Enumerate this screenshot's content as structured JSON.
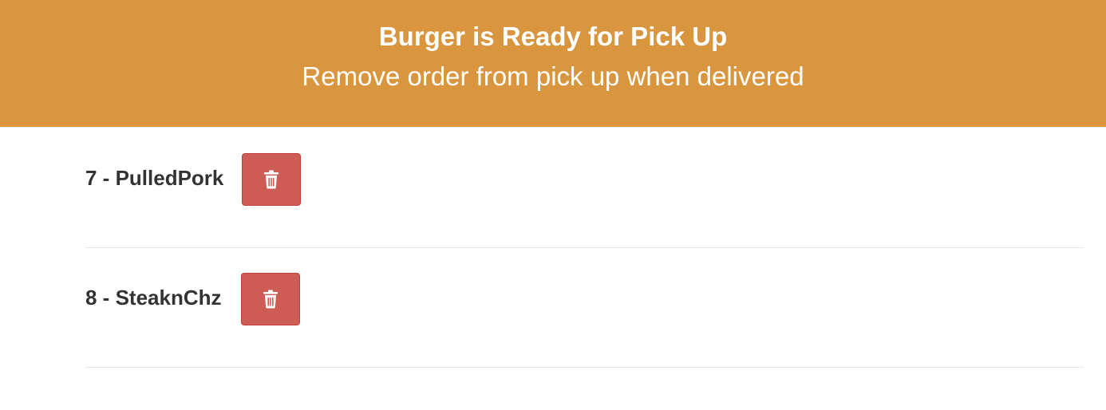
{
  "banner": {
    "title": "Burger is Ready for Pick Up",
    "subtitle": "Remove order from pick up when delivered",
    "background_color": "#d9963e"
  },
  "orders": [
    {
      "label": "7 - PulledPork",
      "action_icon": "trash-icon"
    },
    {
      "label": "8 - SteaknChz",
      "action_icon": "trash-icon"
    }
  ],
  "colors": {
    "danger_button": "#cd5c54",
    "text": "#333333"
  }
}
